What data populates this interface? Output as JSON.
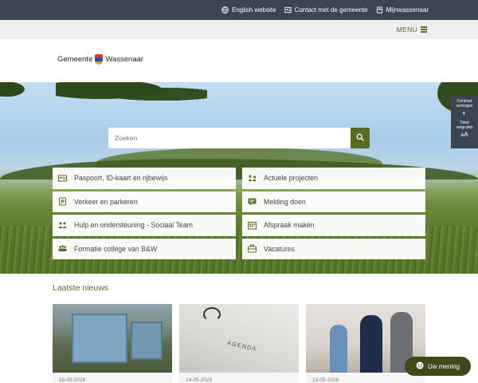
{
  "topbar": {
    "links": [
      {
        "label": "English website",
        "icon": "globe-icon"
      },
      {
        "label": "Contact met de gemeente",
        "icon": "contact-icon"
      },
      {
        "label": "Mijnwassenaar",
        "icon": "portal-icon"
      }
    ]
  },
  "menubar": {
    "menu_label": "MENU"
  },
  "header": {
    "logo_text_1": "Gemeente",
    "logo_text_2": "Wassenaar"
  },
  "search": {
    "placeholder": "Zoeken"
  },
  "quick_links": [
    {
      "label": "Paspoort, ID-kaart en rijbewijs",
      "icon": "id-card-icon"
    },
    {
      "label": "Actuele projecten",
      "icon": "projects-icon"
    },
    {
      "label": "Verkeer en parkeren",
      "icon": "parking-icon"
    },
    {
      "label": "Melding doen",
      "icon": "report-icon"
    },
    {
      "label": "Hulp en ondersteuning - Sociaal Team",
      "icon": "support-icon"
    },
    {
      "label": "Afspraak maken",
      "icon": "appointment-icon"
    },
    {
      "label": "Formatie college van B&W",
      "icon": "council-icon"
    },
    {
      "label": "Vacatures",
      "icon": "briefcase-icon"
    }
  ],
  "accessibility": {
    "contrast_label_1": "Contrast",
    "contrast_label_2": "verhogen",
    "text_label_1": "Tekst",
    "text_label_2": "vergroten",
    "text_glyph": "ᴀA"
  },
  "news": {
    "title": "Laatste nieuws",
    "items": [
      {
        "date": "15-05-2026"
      },
      {
        "date": "14-05-2026",
        "image_text": "AGENDA"
      },
      {
        "date": "13-05-2026"
      }
    ]
  },
  "feedback": {
    "label": "Uw mening"
  },
  "colors": {
    "primary": "#5a6b22",
    "dark": "#3a4452",
    "feedback": "#3f4a18"
  }
}
